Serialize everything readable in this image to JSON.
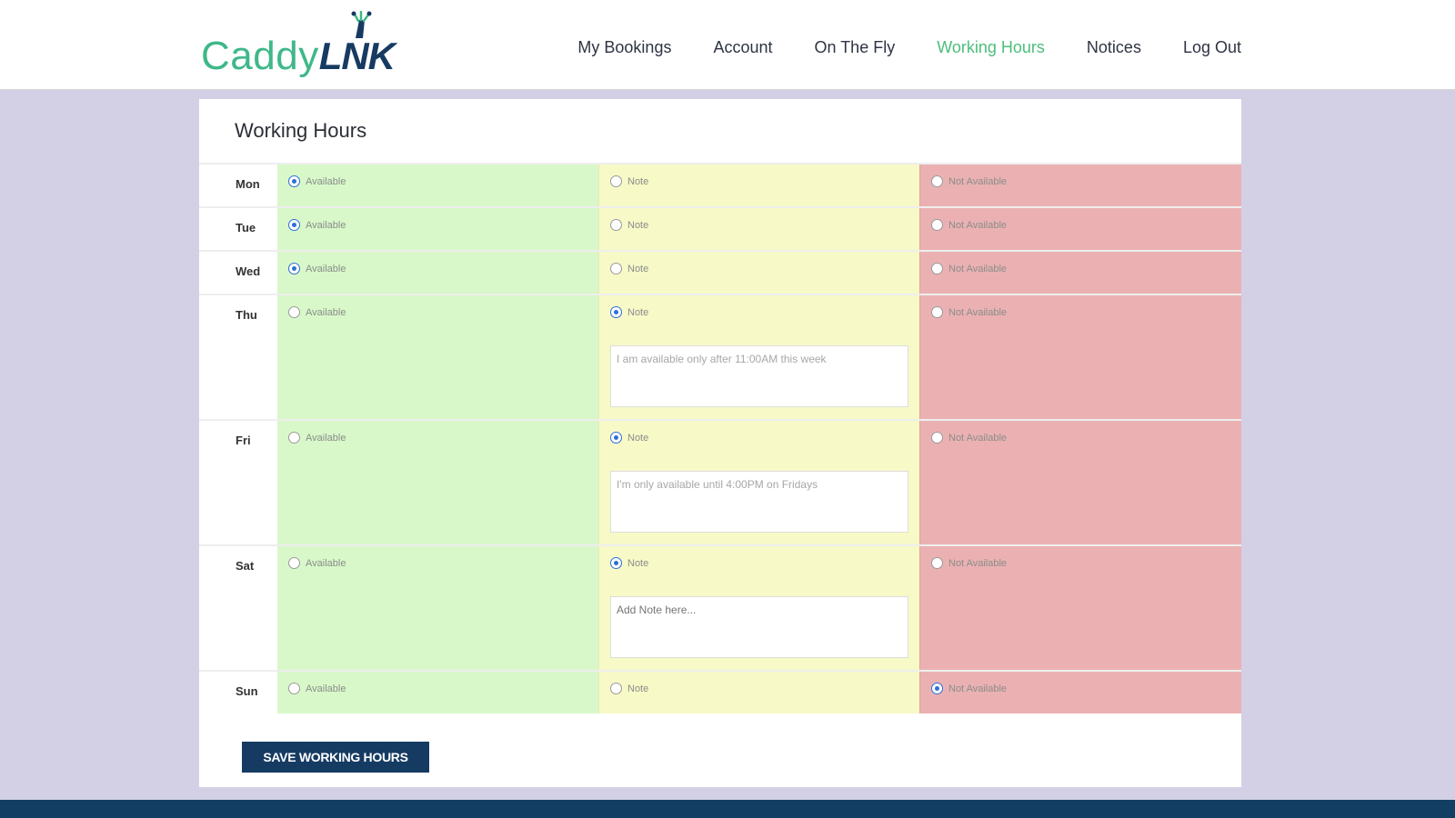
{
  "brand": {
    "part1": "Caddy",
    "part2": "L",
    "part3": "NK",
    "mark_color": "#3fb889",
    "dark_color": "#173a62"
  },
  "nav": {
    "items": [
      {
        "label": "My Bookings"
      },
      {
        "label": "Account"
      },
      {
        "label": "On The Fly"
      },
      {
        "label": "Working Hours",
        "active": true
      },
      {
        "label": "Notices"
      },
      {
        "label": "Log Out"
      }
    ],
    "active_color": "#4cbf7c"
  },
  "panel": {
    "title": "Working Hours"
  },
  "options": {
    "available": "Available",
    "note": "Note",
    "not_available": "Not Available"
  },
  "days": [
    {
      "day": "Mon",
      "selected": "available",
      "note": ""
    },
    {
      "day": "Tue",
      "selected": "available",
      "note": ""
    },
    {
      "day": "Wed",
      "selected": "available",
      "note": ""
    },
    {
      "day": "Thu",
      "selected": "note",
      "note": "I am available only after 11:00AM this week"
    },
    {
      "day": "Fri",
      "selected": "note",
      "note": "I'm only available until 4:00PM on Fridays"
    },
    {
      "day": "Sat",
      "selected": "note",
      "note": "",
      "placeholder": "Add Note here..."
    },
    {
      "day": "Sun",
      "selected": "not_available",
      "note": ""
    }
  ],
  "save_button": "SAVE WORKING HOURS",
  "colors": {
    "available_bg": "#d8f8c9",
    "note_bg": "#f7f9c7",
    "not_available_bg": "#ebb1b2",
    "button_bg": "#163b63",
    "page_bg": "#d3d0e6"
  }
}
